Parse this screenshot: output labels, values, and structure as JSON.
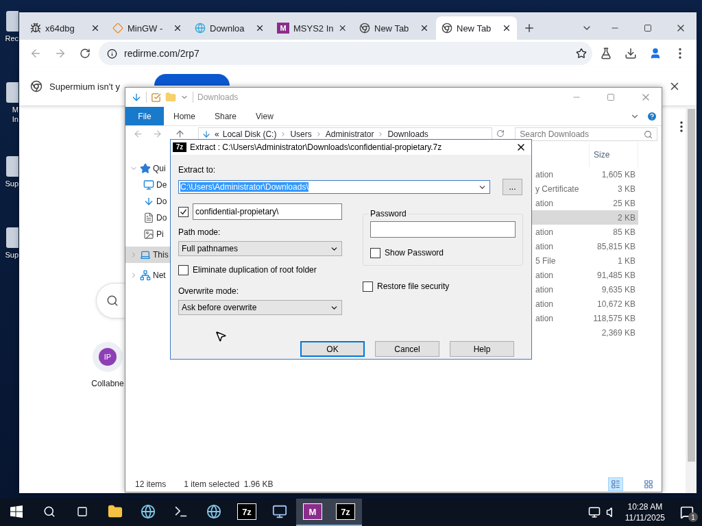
{
  "desktop": {
    "icons": [
      {
        "lines": [
          "Rec"
        ]
      },
      {
        "lines": [
          "M",
          "In"
        ]
      },
      {
        "lines": [
          "Sup"
        ]
      },
      {
        "lines": [
          "Sup"
        ]
      }
    ]
  },
  "browser": {
    "tabs": [
      {
        "title": "x64dbg",
        "kind": "bug",
        "selected": false
      },
      {
        "title": "MinGW -",
        "kind": "diamond",
        "selected": false
      },
      {
        "title": "Downloa",
        "kind": "globe",
        "selected": false
      },
      {
        "title": "MSYS2 In",
        "kind": "logo",
        "logo": "M",
        "selected": false
      },
      {
        "title": "New Tab",
        "kind": "chrome",
        "selected": false
      },
      {
        "title": "New Tab",
        "kind": "chrome",
        "selected": true
      }
    ],
    "url": "redirme.com/2rp7",
    "banner": {
      "text": "Supermium isn't y"
    },
    "page": {
      "initials": "IP",
      "shortcut": "Collabne"
    }
  },
  "explorer": {
    "title": "Downloads",
    "file_menu": "File",
    "ribbon_tabs": [
      "Home",
      "Share",
      "View"
    ],
    "breadcrumb_overflow": "«",
    "breadcrumb": [
      "Local Disk (C:)",
      "Users",
      "Administrator",
      "Downloads"
    ],
    "search": {
      "placeholder": "Search Downloads"
    },
    "nav": [
      {
        "label": "Qui",
        "kind": "star",
        "expanded": true,
        "selected": false,
        "children": [
          {
            "label": "De",
            "kind": "desktop",
            "selected": false
          },
          {
            "label": "Do",
            "kind": "download",
            "selected": false
          },
          {
            "label": "Do",
            "kind": "document",
            "selected": false
          },
          {
            "label": "Pi",
            "kind": "picture",
            "selected": false
          }
        ]
      },
      {
        "label": "This",
        "kind": "pc",
        "expanded": false,
        "selected": true
      },
      {
        "label": "Net",
        "kind": "network",
        "expanded": false,
        "selected": false
      }
    ],
    "size_column": "Size",
    "rows": [
      {
        "type": "ation",
        "size": "1,605 KB",
        "selected": false
      },
      {
        "type": "y Certificate",
        "size": "3 KB",
        "selected": false
      },
      {
        "type": "ation",
        "size": "25 KB",
        "selected": false
      },
      {
        "type": "",
        "size": "2 KB",
        "selected": true
      },
      {
        "type": "ation",
        "size": "85 KB",
        "selected": false
      },
      {
        "type": "ation",
        "size": "85,815 KB",
        "selected": false
      },
      {
        "type": "5 File",
        "size": "1 KB",
        "selected": false
      },
      {
        "type": "ation",
        "size": "91,485 KB",
        "selected": false
      },
      {
        "type": "ation",
        "size": "9,635 KB",
        "selected": false
      },
      {
        "type": "ation",
        "size": "10,672 KB",
        "selected": false
      },
      {
        "type": "ation",
        "size": "118,575 KB",
        "selected": false
      },
      {
        "type": "",
        "size": "2,369 KB",
        "selected": false
      }
    ],
    "status": {
      "count": "12 items",
      "selection": "1 item selected  1.96 KB"
    }
  },
  "dialog": {
    "logo": "7z",
    "title": "Extract : C:\\Users\\Administrator\\Downloads\\confidential-propietary.7z",
    "extract_label": "Extract to:",
    "extract_path": "C:\\Users\\Administrator\\Downloads\\",
    "browse": "...",
    "subfolder": {
      "checked": true,
      "value": "confidential-propietary\\"
    },
    "path_mode": {
      "label": "Path mode:",
      "value": "Full pathnames"
    },
    "eliminate": {
      "label": "Eliminate duplication of root folder",
      "checked": false
    },
    "overwrite": {
      "label": "Overwrite mode:",
      "value": "Ask before overwrite"
    },
    "password": {
      "label": "Password"
    },
    "show_password": {
      "label": "Show Password",
      "checked": false
    },
    "restore": {
      "label": "Restore file security",
      "checked": false
    },
    "buttons": [
      {
        "label": "OK",
        "default": true
      },
      {
        "label": "Cancel",
        "default": false
      },
      {
        "label": "Help",
        "default": false
      }
    ]
  },
  "taskbar": {
    "apps": [
      {
        "kind": "explorer",
        "active": false
      },
      {
        "kind": "globe",
        "active": false
      },
      {
        "kind": "terminal",
        "active": false
      },
      {
        "kind": "globe",
        "active": false
      },
      {
        "kind": "logo",
        "logo": "7z",
        "active": false
      },
      {
        "kind": "remote",
        "active": false
      },
      {
        "kind": "logo",
        "logo": "M",
        "active": true
      },
      {
        "kind": "logo",
        "logo": "7z",
        "active": true
      }
    ],
    "time": "10:28 AM",
    "date": "11/11/2025",
    "notifications": "1"
  }
}
